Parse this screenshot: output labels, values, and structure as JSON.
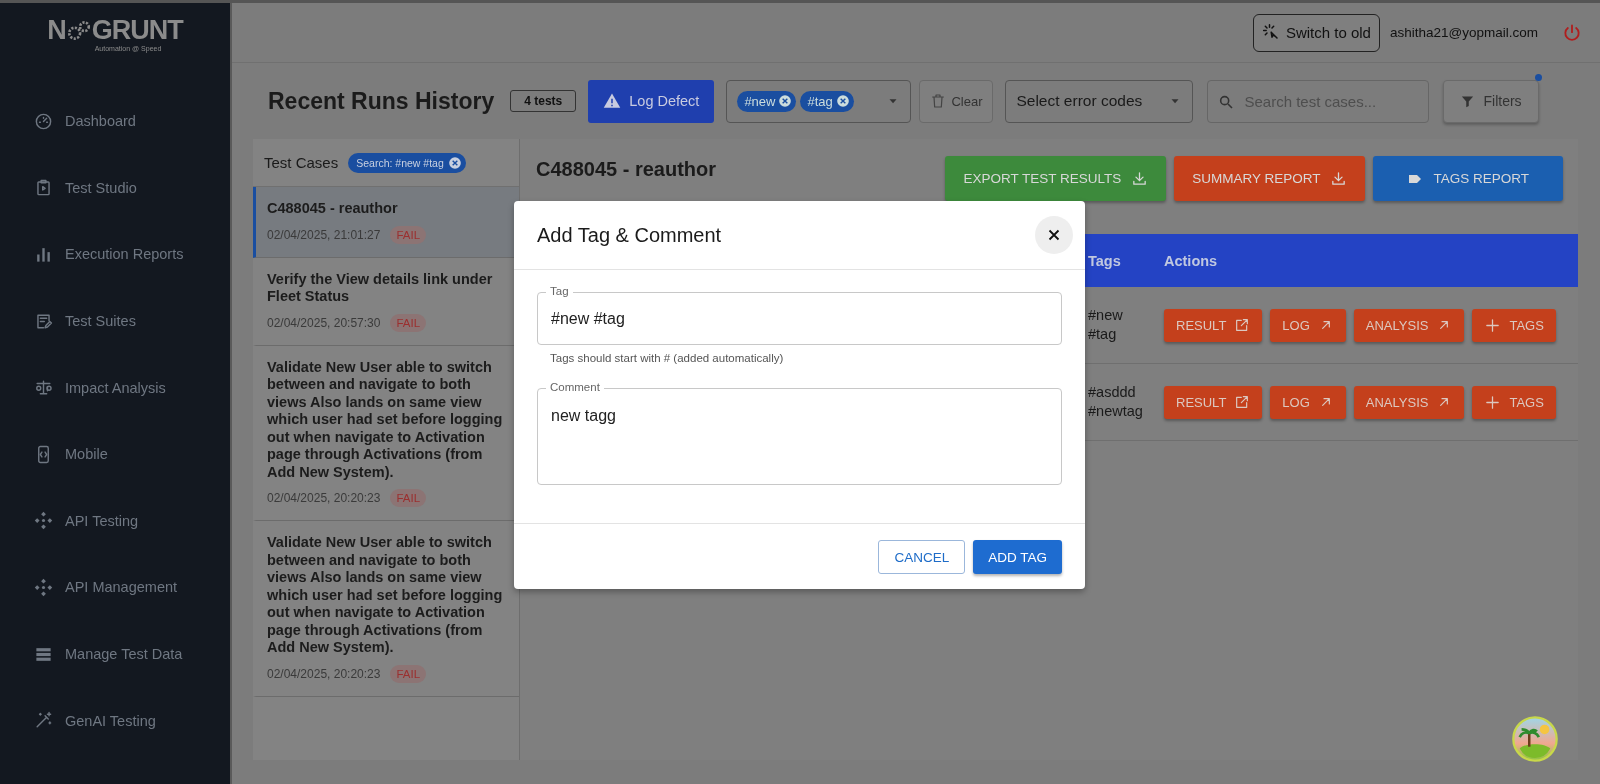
{
  "logo": {
    "text_before": "N",
    "text_after": "GRUNT",
    "tagline": "Automation @ Speed"
  },
  "sidebar": {
    "items": [
      {
        "label": "Dashboard",
        "kind": "gauge"
      },
      {
        "label": "Test Studio",
        "kind": "clipboard"
      },
      {
        "label": "Execution Reports",
        "kind": "bars"
      },
      {
        "label": "Test Suites",
        "kind": "edit"
      },
      {
        "label": "Impact Analysis",
        "kind": "scale"
      },
      {
        "label": "Mobile",
        "kind": "mobile"
      },
      {
        "label": "API Testing",
        "kind": "api"
      },
      {
        "label": "API Management",
        "kind": "api"
      },
      {
        "label": "Manage Test Data",
        "kind": "stack"
      },
      {
        "label": "GenAI Testing",
        "kind": "wand"
      }
    ]
  },
  "header": {
    "switch_button": "Switch to old",
    "user_email": "ashitha21@yopmail.com"
  },
  "toolbar": {
    "title": "Recent Runs History",
    "count": "4 tests",
    "log_defect_button": "Log Defect",
    "tag_filter": {
      "chips": [
        "#new",
        "#tag"
      ]
    },
    "clear_button": "Clear",
    "error_codes_select": {
      "placeholder": "Select error codes"
    },
    "search": {
      "placeholder": "Search test cases..."
    },
    "filters_button": {
      "label": "Filters",
      "indicator": true
    }
  },
  "test_cases": {
    "heading": "Test Cases",
    "search_chip": "Search: #new #tag",
    "items": [
      {
        "title": "C488045 - reauthor",
        "time": "02/04/2025, 21:01:27",
        "status": "FAIL",
        "selected": true
      },
      {
        "title": "Verify the View details link under Fleet Status",
        "time": "02/04/2025, 20:57:30",
        "status": "FAIL",
        "selected": false
      },
      {
        "title": "Validate New User able to switch between and navigate to both views Also lands on same view which user had set before logging out when navigate to Activation page through Activations (from Add New System).",
        "time": "02/04/2025, 20:20:23",
        "status": "FAIL",
        "selected": false
      },
      {
        "title": "Validate New User able to switch between and navigate to both views Also lands on same view which user had set before logging out when navigate to Activation page through Activations (from Add New System).",
        "time": "02/04/2025, 20:20:23",
        "status": "FAIL",
        "selected": false
      }
    ]
  },
  "detail": {
    "title": "C488045 - reauthor",
    "buttons": [
      {
        "label": "EXPORT TEST RESULTS",
        "kind": "download",
        "color": "#3d8a3c"
      },
      {
        "label": "SUMMARY REPORT",
        "kind": "download",
        "color": "#c4401c"
      },
      {
        "label": "TAGS REPORT",
        "kind": "tag",
        "color": "#1b5fb0"
      }
    ]
  },
  "table": {
    "columns": [
      "Tags",
      "Actions"
    ],
    "rows": [
      {
        "tags": [
          "#new",
          "#tag"
        ],
        "actions": [
          {
            "label": "RESULT",
            "kind": "external"
          },
          {
            "label": "LOG",
            "kind": "arrow"
          },
          {
            "label": "ANALYSIS",
            "kind": "arrow"
          },
          {
            "label": "TAGS",
            "kind": "plus"
          }
        ]
      },
      {
        "tags": [
          "#asddd",
          "#newtag"
        ],
        "actions": [
          {
            "label": "RESULT",
            "kind": "external"
          },
          {
            "label": "LOG",
            "kind": "arrow"
          },
          {
            "label": "ANALYSIS",
            "kind": "arrow"
          },
          {
            "label": "TAGS",
            "kind": "plus"
          }
        ]
      }
    ]
  },
  "modal": {
    "title": "Add Tag & Comment",
    "tag_field": {
      "label": "Tag",
      "value": "#new #tag",
      "helper": "Tags should start with # (added automatically)"
    },
    "comment_field": {
      "label": "Comment",
      "value": "new tagg"
    },
    "cancel_button": "CANCEL",
    "add_button": "ADD TAG"
  }
}
